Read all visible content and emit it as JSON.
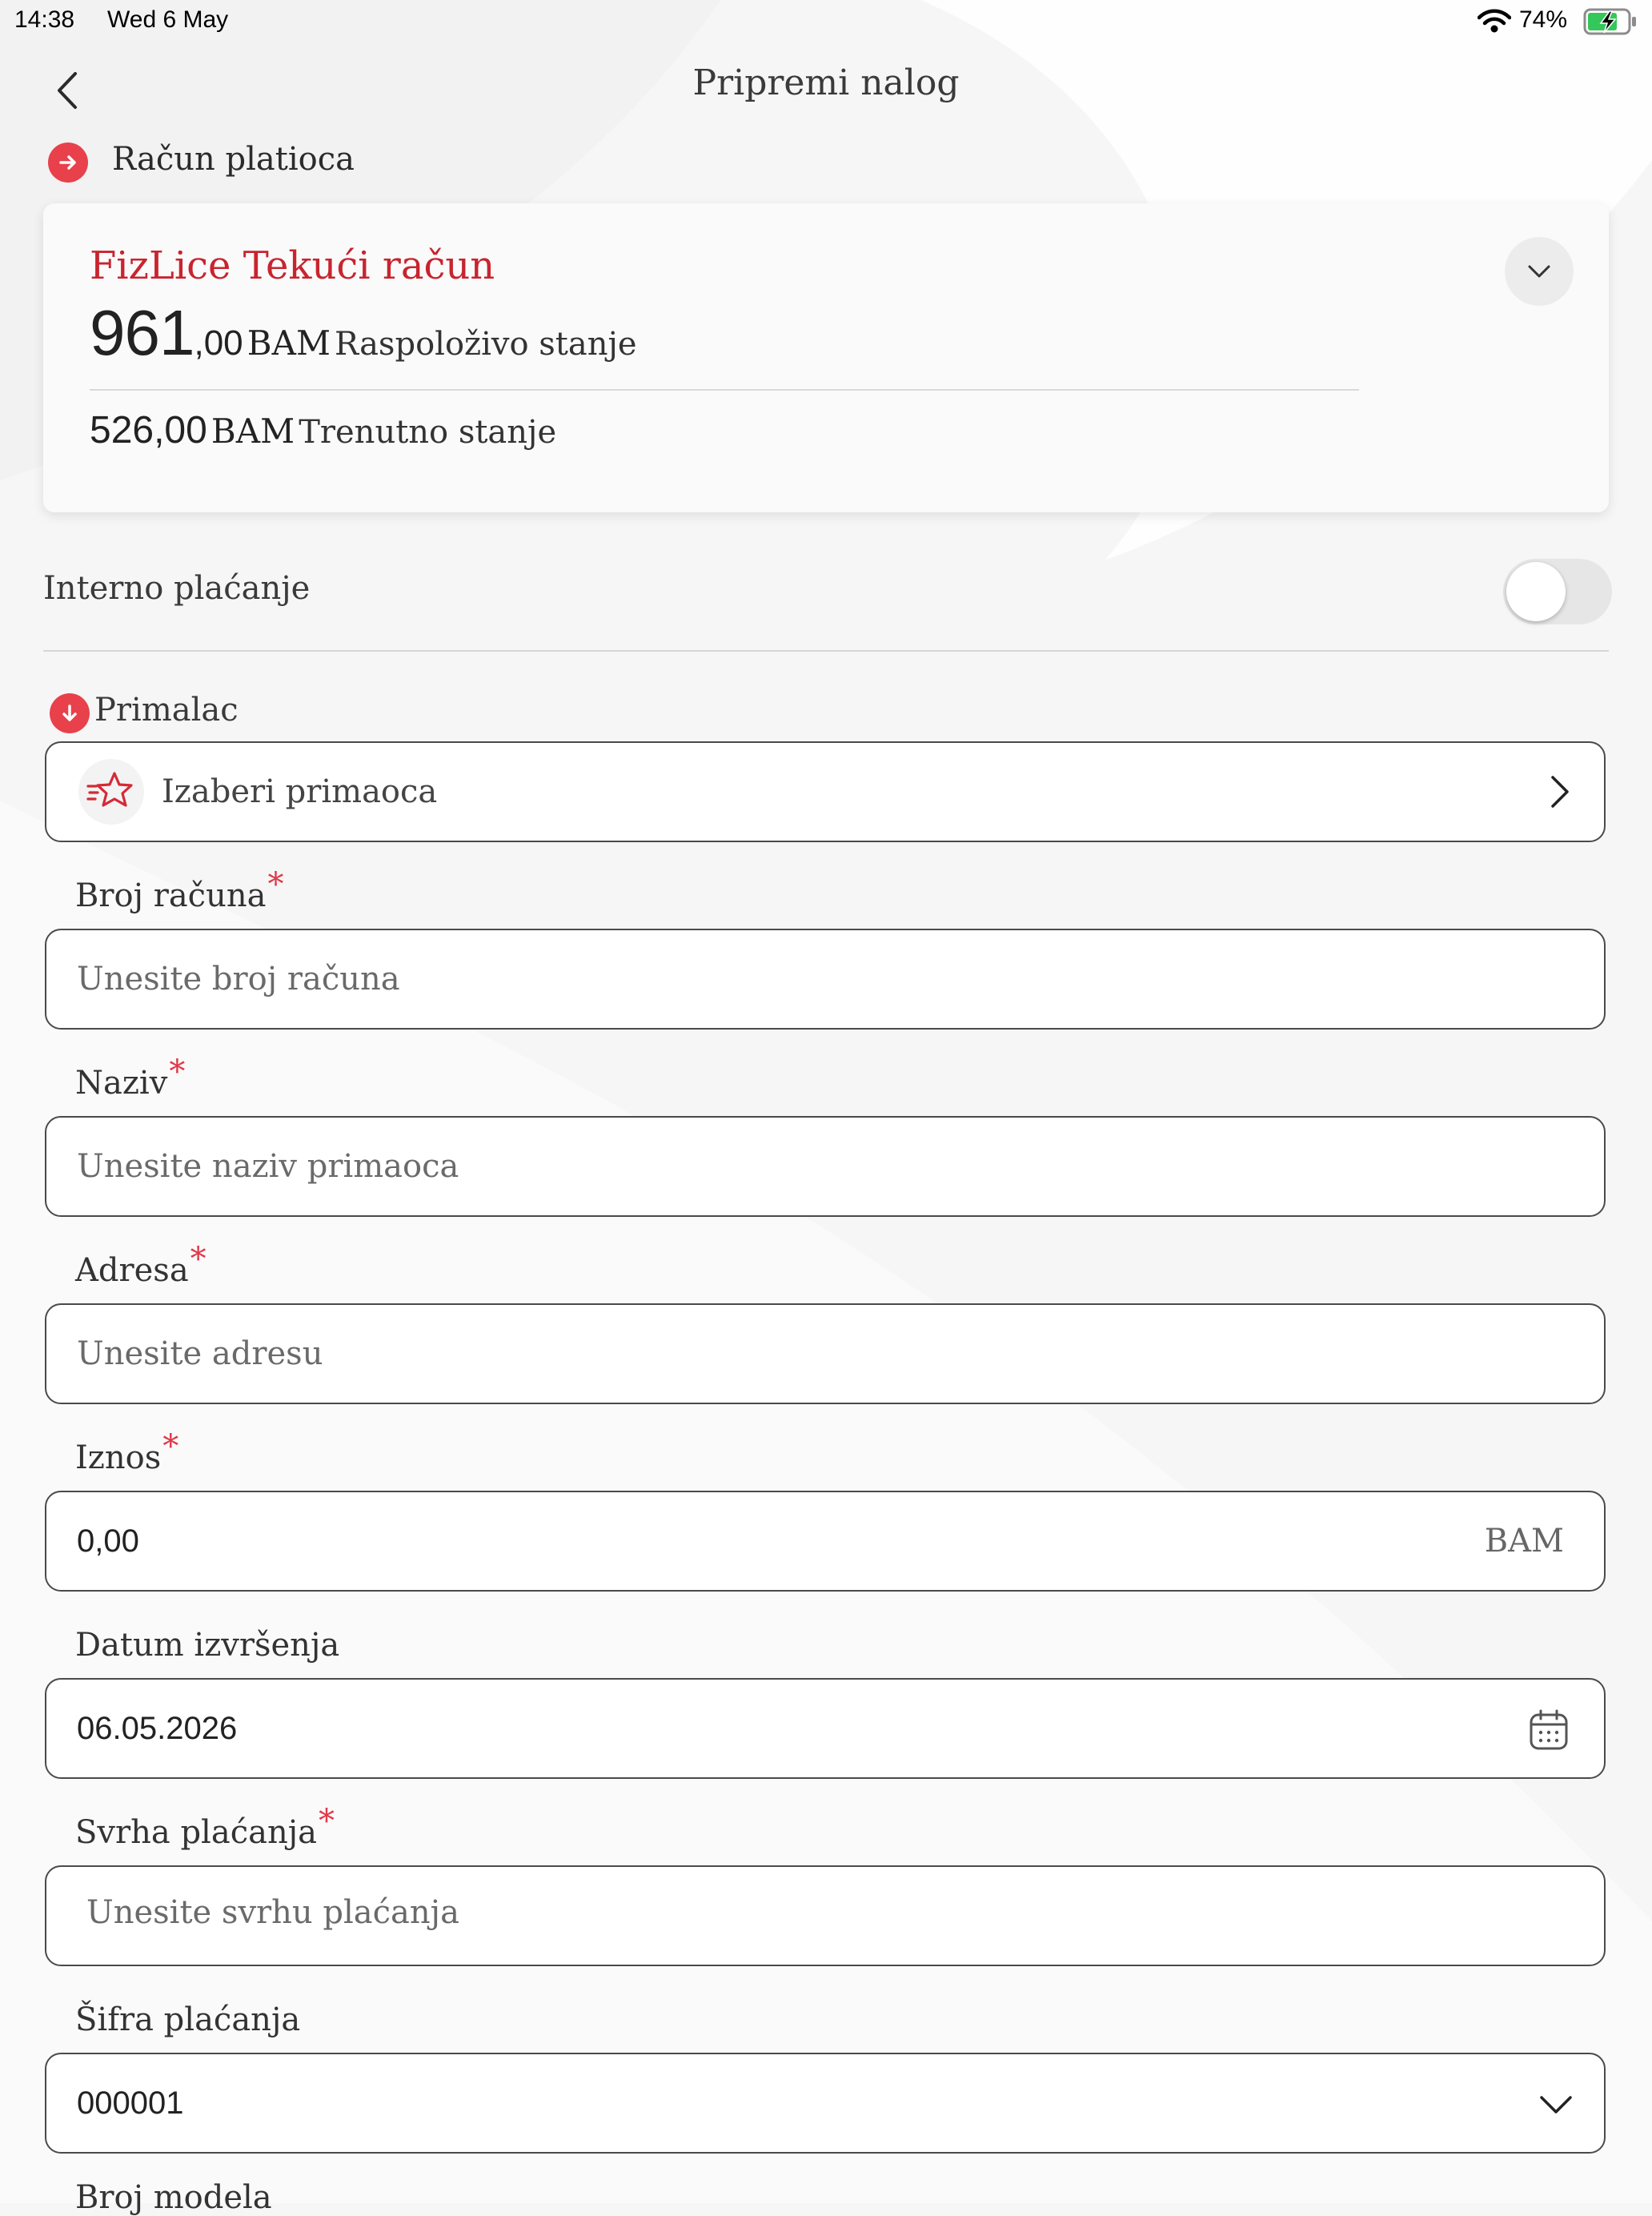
{
  "status_bar": {
    "time": "14:38",
    "date": "Wed 6 May",
    "battery_percent": "74%"
  },
  "header": {
    "title": "Pripremi nalog"
  },
  "payer": {
    "section_label": "Račun platioca",
    "account_name": "FizLice Tekući račun",
    "available_whole": "961",
    "available_decimal": ",00",
    "available_currency": "BAM",
    "available_label": "Raspoloživo stanje",
    "current_amount": "526,00",
    "current_currency": "BAM",
    "current_label": "Trenutno stanje"
  },
  "internal_payment": {
    "label": "Interno plaćanje",
    "enabled": false
  },
  "recipient": {
    "section_label": "Primalac",
    "choose_label": "Izaberi primaoca"
  },
  "form": {
    "account_number": {
      "label": "Broj računa",
      "required": "*",
      "placeholder": "Unesite broj računa"
    },
    "name": {
      "label": "Naziv",
      "required": "*",
      "placeholder": "Unesite naziv primaoca"
    },
    "address": {
      "label": "Adresa",
      "required": "*",
      "placeholder": "Unesite adresu"
    },
    "amount": {
      "label": "Iznos",
      "required": "*",
      "value": "0,00",
      "currency": "BAM"
    },
    "execution_date": {
      "label": "Datum izvršenja",
      "value": "06.05.2026"
    },
    "purpose": {
      "label": "Svrha plaćanja",
      "required": "*",
      "placeholder": "Unesite svrhu plaćanja"
    },
    "payment_code": {
      "label": "Šifra plaćanja",
      "value": "000001"
    },
    "next_label_cut": "Broj modela"
  },
  "colors": {
    "accent_red": "#c8242f",
    "icon_red": "#e8414b",
    "battery_green": "#34c759"
  },
  "icons": [
    "back-arrow-icon",
    "arrow-right-icon",
    "chevron-down-icon",
    "arrow-down-icon",
    "star-icon",
    "chevron-right-icon",
    "calendar-icon",
    "wifi-icon",
    "battery-icon"
  ]
}
